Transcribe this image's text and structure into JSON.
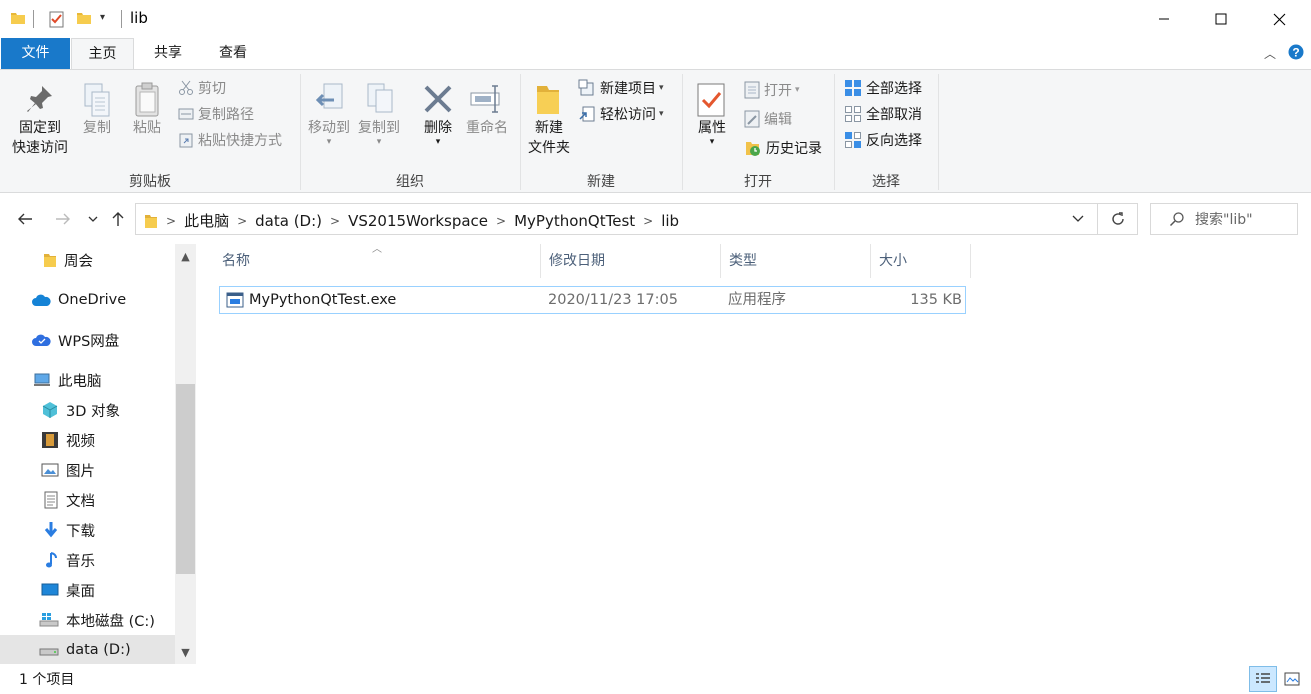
{
  "window": {
    "title": "lib",
    "minimize_icon": "minimize-icon",
    "maximize_icon": "maximize-icon",
    "close_icon": "close-icon"
  },
  "tabs": [
    {
      "label": "文件"
    },
    {
      "label": "主页"
    },
    {
      "label": "共享"
    },
    {
      "label": "查看"
    }
  ],
  "ribbon": {
    "clipboard": {
      "pin_label_1": "固定到",
      "pin_label_2": "快速访问",
      "copy": "复制",
      "paste": "粘贴",
      "cut": "剪切",
      "copy_path": "复制路径",
      "paste_shortcut": "粘贴快捷方式",
      "group_label": "剪贴板"
    },
    "organize": {
      "move_to": "移动到",
      "copy_to": "复制到",
      "delete": "删除",
      "rename": "重命名",
      "group_label": "组织"
    },
    "new": {
      "new_item": "新建项目",
      "easy_access": "轻松访问",
      "new_folder_1": "新建",
      "new_folder_2": "文件夹",
      "group_label": "新建"
    },
    "open": {
      "properties": "属性",
      "open": "打开",
      "edit": "编辑",
      "history": "历史记录",
      "group_label": "打开"
    },
    "select": {
      "select_all": "全部选择",
      "select_none": "全部取消",
      "invert": "反向选择",
      "group_label": "选择"
    }
  },
  "address": {
    "crumbs": [
      "此电脑",
      "data (D:)",
      "VS2015Workspace",
      "MyPythonQtTest",
      "lib"
    ],
    "search_placeholder": "搜索\"lib\""
  },
  "nav_pane": {
    "items": [
      {
        "label": "周会",
        "icon": "folder-icon"
      },
      {
        "label": "OneDrive",
        "icon": "onedrive-cloud-icon"
      },
      {
        "label": "WPS网盘",
        "icon": "wps-cloud-icon"
      },
      {
        "label": "此电脑",
        "icon": "computer-icon"
      },
      {
        "label": "3D 对象",
        "icon": "cube-3d-icon"
      },
      {
        "label": "视频",
        "icon": "video-icon"
      },
      {
        "label": "图片",
        "icon": "pictures-icon"
      },
      {
        "label": "文档",
        "icon": "documents-icon"
      },
      {
        "label": "下载",
        "icon": "download-arrow-icon"
      },
      {
        "label": "音乐",
        "icon": "music-note-icon"
      },
      {
        "label": "桌面",
        "icon": "desktop-icon"
      },
      {
        "label": "本地磁盘 (C:)",
        "icon": "windows-drive-icon"
      },
      {
        "label": "data (D:)",
        "icon": "drive-icon"
      }
    ]
  },
  "file_list": {
    "columns": [
      "名称",
      "修改日期",
      "类型",
      "大小"
    ],
    "rows": [
      {
        "name": "MyPythonQtTest.exe",
        "modified": "2020/11/23 17:05",
        "type": "应用程序",
        "size": "135 KB",
        "icon": "exe-app-icon"
      }
    ]
  },
  "status": {
    "item_count": "1 个项目"
  },
  "colors": {
    "file_tab": "#1979ca",
    "selection": "#cce8ff",
    "ribbon_bg": "#f5f6f7",
    "header_text": "#4c607a"
  }
}
